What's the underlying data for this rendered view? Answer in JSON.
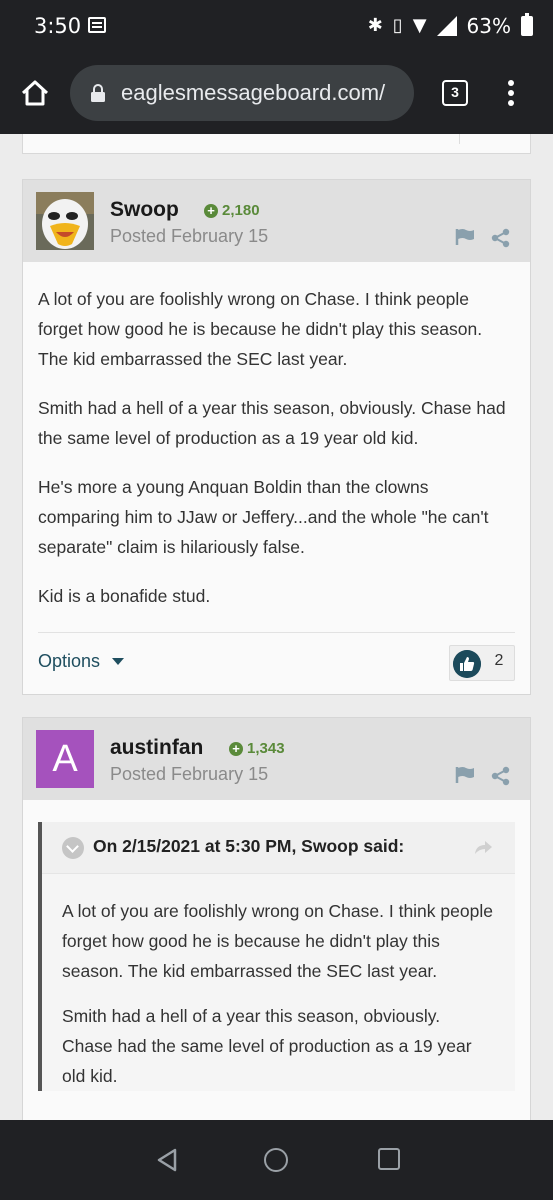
{
  "status_bar": {
    "time": "3:50",
    "battery": "63%"
  },
  "browser": {
    "url": "eaglesmessageboard.com/",
    "tab_count": "3"
  },
  "posts": [
    {
      "author": "Swoop",
      "reputation": "2,180",
      "date": "Posted February 15",
      "avatar": "eagle-mascot",
      "paragraphs": [
        "A lot of you are foolishly wrong on Chase. I think people forget how good he is because he didn't play this season. The kid embarrassed the SEC last year.",
        "Smith had a hell of a year this season, obviously. Chase had the same level of production as a 19 year old kid.",
        "He's more a young Anquan Boldin than the clowns comparing him to JJaw or Jeffery...and the whole \"he can't separate\" claim is hilariously false.",
        "Kid is a bonafide stud."
      ],
      "options_label": "Options",
      "like_count": "2"
    },
    {
      "author": "austinfan",
      "reputation": "1,343",
      "date": "Posted February 15",
      "avatar_letter": "A",
      "quote": {
        "citation": "On 2/15/2021 at 5:30 PM, Swoop said:",
        "paragraphs": [
          "A lot of you are foolishly wrong on Chase. I think people forget how good he is because he didn't play this season. The kid embarrassed the SEC last year.",
          "Smith had a hell of a year this season, obviously. Chase had the same level of production as a 19 year old kid."
        ]
      }
    }
  ],
  "colors": {
    "accent": "#1c4a5b",
    "reputation": "#5a8a3a",
    "avatar_bg": "#a552bd"
  }
}
